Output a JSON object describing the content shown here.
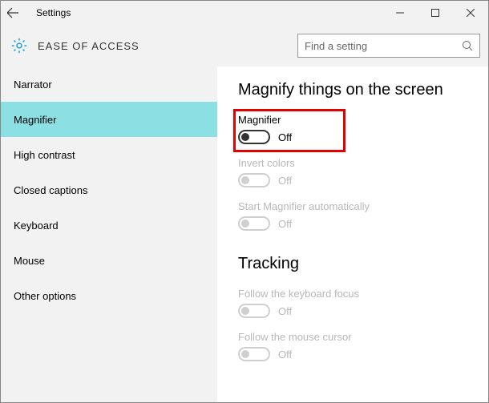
{
  "titlebar": {
    "title": "Settings"
  },
  "header": {
    "title": "EASE OF ACCESS"
  },
  "search": {
    "placeholder": "Find a setting"
  },
  "sidebar": {
    "items": [
      {
        "label": "Narrator"
      },
      {
        "label": "Magnifier"
      },
      {
        "label": "High contrast"
      },
      {
        "label": "Closed captions"
      },
      {
        "label": "Keyboard"
      },
      {
        "label": "Mouse"
      },
      {
        "label": "Other options"
      }
    ]
  },
  "main": {
    "section1": {
      "heading": "Magnify things on the screen",
      "settings": [
        {
          "label": "Magnifier",
          "state": "Off"
        },
        {
          "label": "Invert colors",
          "state": "Off"
        },
        {
          "label": "Start Magnifier automatically",
          "state": "Off"
        }
      ]
    },
    "section2": {
      "heading": "Tracking",
      "settings": [
        {
          "label": "Follow the keyboard focus",
          "state": "Off"
        },
        {
          "label": "Follow the mouse cursor",
          "state": "Off"
        }
      ]
    }
  }
}
